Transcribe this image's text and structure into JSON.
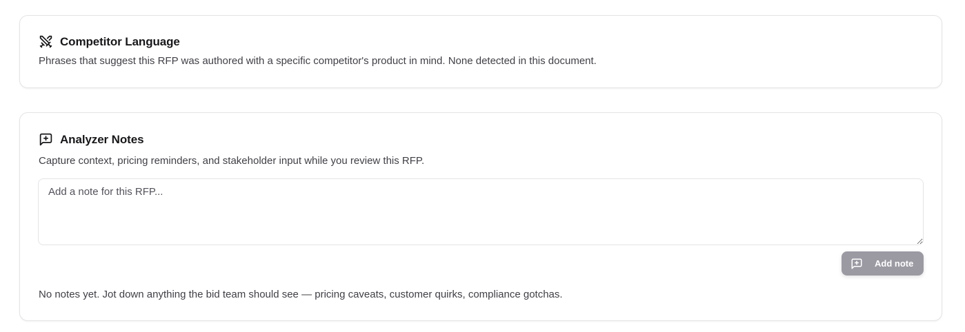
{
  "competitor": {
    "title": "Competitor Language",
    "description": "Phrases that suggest this RFP was authored with a specific competitor's product in mind. None detected in this document.",
    "icon": "crossed-swords-icon"
  },
  "notes": {
    "title": "Analyzer Notes",
    "description": "Capture context, pricing reminders, and stakeholder input while you review this RFP.",
    "icon": "message-plus-icon",
    "input": {
      "value": "",
      "placeholder": "Add a note for this RFP..."
    },
    "add_button_label": "Add note",
    "empty_state": "No notes yet. Jot down anything the bid team should see — pricing caveats, customer quirks, compliance gotchas."
  },
  "colors": {
    "border": "#e4e4e7",
    "button_disabled_bg": "#9b9aa3",
    "text_primary": "#18181b",
    "text_secondary": "#3f3f46"
  }
}
